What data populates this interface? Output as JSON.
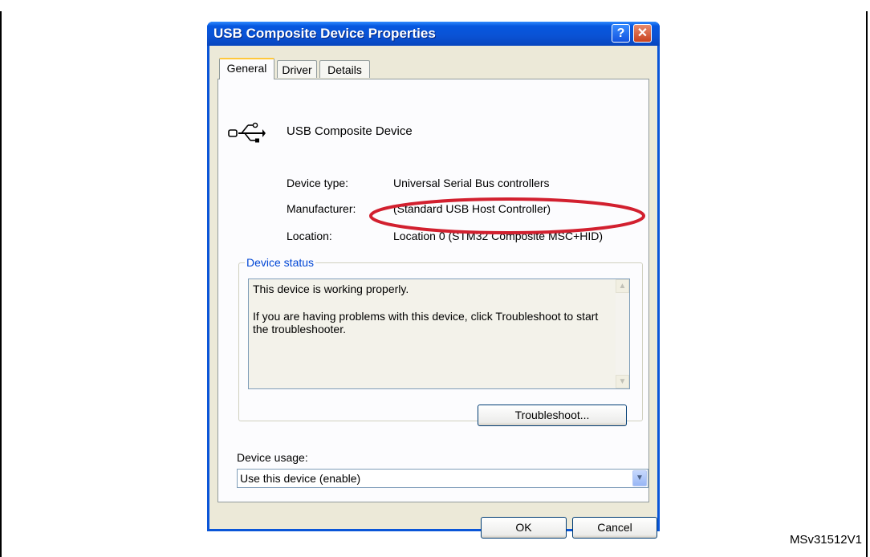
{
  "figure": {
    "caption": "",
    "reference": "MSv31512V1"
  },
  "dialog": {
    "title": "USB Composite Device Properties",
    "help_label": "?",
    "close_label": "✕",
    "tabs": [
      "General",
      "Driver",
      "Details"
    ],
    "device_icon": "usb-icon",
    "device_name": "USB Composite Device",
    "properties": {
      "device_type_label": "Device type:",
      "device_type_value": "Universal Serial Bus controllers",
      "manufacturer_label": "Manufacturer:",
      "manufacturer_value": "(Standard USB Host Controller)",
      "location_label": "Location:",
      "location_value": "Location 0 (STM32 Composite MSC+HID)"
    },
    "device_status": {
      "group_label": "Device status",
      "line1": "This device is working properly.",
      "line2": "If you are having problems with this device, click Troubleshoot to start the troubleshooter."
    },
    "troubleshoot_label": "Troubleshoot...",
    "device_usage": {
      "label": "Device usage:",
      "selected": "Use this device (enable)"
    },
    "ok_label": "OK",
    "cancel_label": "Cancel"
  },
  "colors": {
    "title_bar": "#0a52d4",
    "highlight_ellipse": "#d2202f",
    "dialog_face": "#ece9d8",
    "group_title": "#0046d5"
  }
}
